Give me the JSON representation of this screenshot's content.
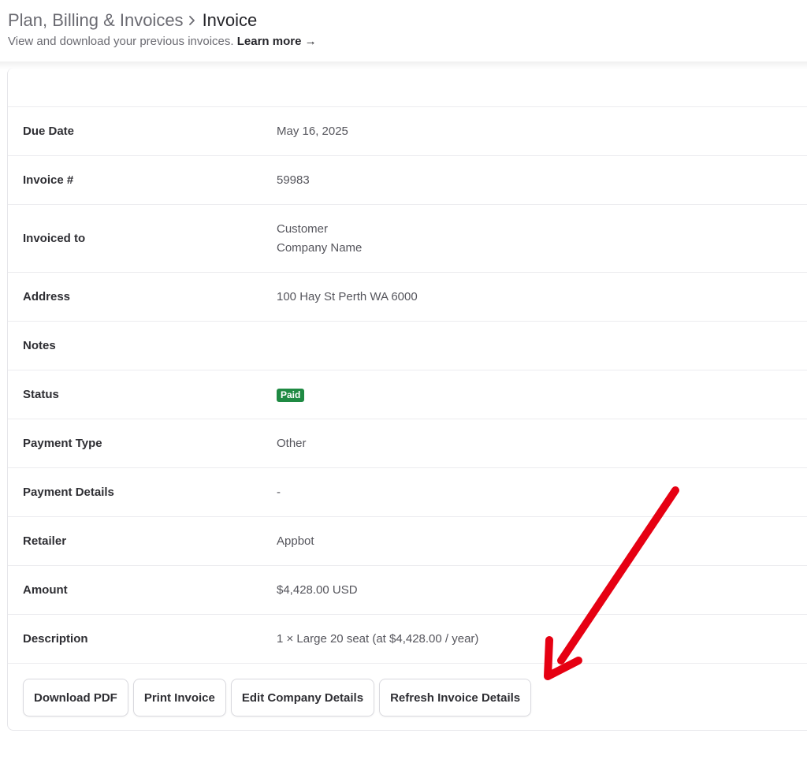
{
  "header": {
    "breadcrumb_parent": "Plan, Billing & Invoices",
    "breadcrumb_current": "Invoice",
    "subtitle": "View and download your previous invoices.",
    "learn_more": "Learn more",
    "learn_more_arrow": "→"
  },
  "invoice": {
    "rows": [
      {
        "label": "Due Date",
        "value": "May 16, 2025"
      },
      {
        "label": "Invoice #",
        "value": "59983"
      },
      {
        "label": "Invoiced to",
        "value_line1": "Customer",
        "value_line2": "Company Name"
      },
      {
        "label": "Address",
        "value": "100 Hay St Perth WA 6000"
      },
      {
        "label": "Notes",
        "value": ""
      },
      {
        "label": "Status",
        "badge": "Paid"
      },
      {
        "label": "Payment Type",
        "value": "Other"
      },
      {
        "label": "Payment Details",
        "value": "-"
      },
      {
        "label": "Retailer",
        "value": "Appbot"
      },
      {
        "label": "Amount",
        "value": "$4,428.00 USD"
      },
      {
        "label": "Description",
        "value": "1 × Large 20 seat (at $4,428.00 / year)"
      }
    ]
  },
  "actions": {
    "download_pdf": "Download PDF",
    "print_invoice": "Print Invoice",
    "edit_company_details": "Edit Company Details",
    "refresh_invoice_details": "Refresh Invoice Details"
  },
  "colors": {
    "status_paid": "#1f8a43",
    "annotation_arrow": "#e60012"
  }
}
